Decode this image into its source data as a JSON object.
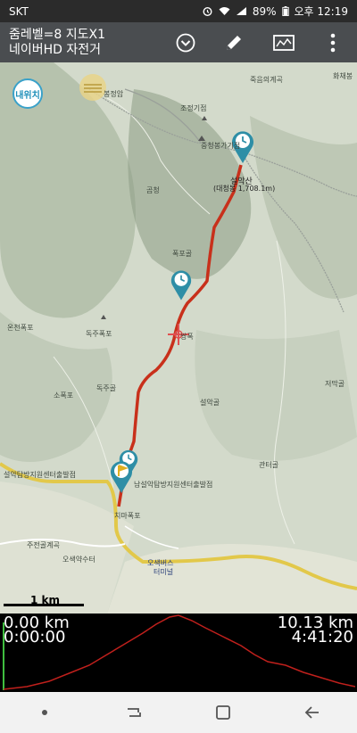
{
  "status_bar": {
    "carrier": "SKT",
    "battery": "89%",
    "time": "오후 12:19"
  },
  "app_bar": {
    "title_line1": "줌레벨=8 지도X1",
    "title_line2": "네이버HD 자전거",
    "icons": [
      "chevron-down-icon",
      "pencil-icon",
      "map-icon",
      "more-icon"
    ]
  },
  "map": {
    "my_location_label": "내위치",
    "scale_label": "1 km",
    "labels": [
      "봉정암",
      "조정기점",
      "중청봉가기점",
      "설악산",
      "(대청봉 1,708.1m)",
      "죽음의계곡",
      "화채봉",
      "곰청",
      "폭포골",
      "온천폭포",
      "독주폭포",
      "소폭포",
      "독주골",
      "설악골",
      "저막골",
      "관터골",
      "설악탐방지원센터출발점",
      "남설악탐방지원센터출발점",
      "치마폭포",
      "주전골계곡",
      "오색약수터",
      "오색버스",
      "터미널",
      "쌍폭"
    ]
  },
  "elevation": {
    "start_distance": "0.00 km",
    "start_time": "0:00:00",
    "total_distance": "10.13 km",
    "total_time": "4:41:20"
  },
  "colors": {
    "track": "#c8301b",
    "marker": "#2e8ea6",
    "profile": "#c0201c",
    "app_bar": "#4a4d50"
  }
}
